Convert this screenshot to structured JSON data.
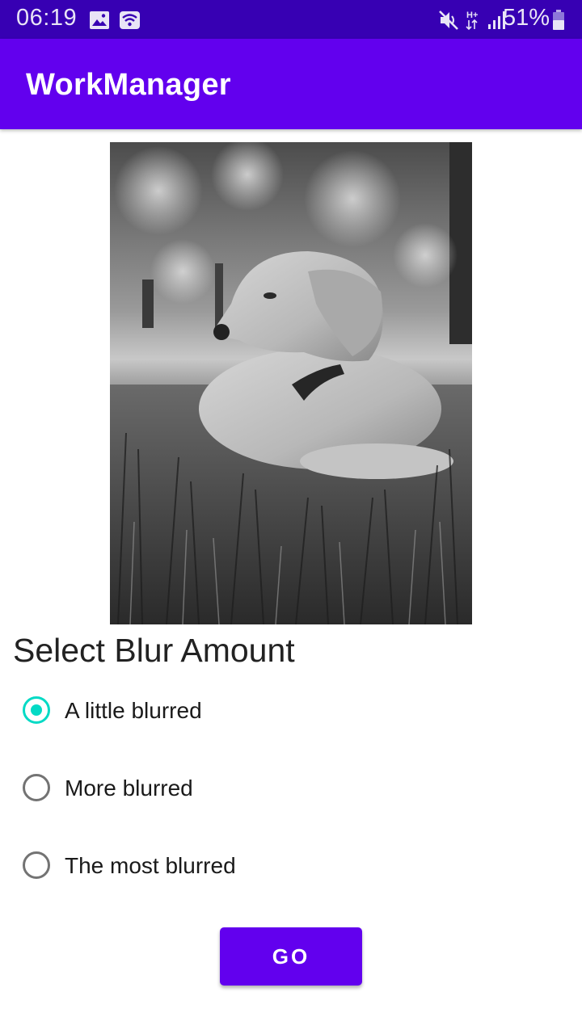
{
  "status_bar": {
    "time": "06:19",
    "battery_percent": "51%",
    "network_label": "H+",
    "left_icons": [
      "gallery-icon",
      "wifi-icon"
    ],
    "right_icons": [
      "mute-icon",
      "network-type-icon",
      "signal-icon",
      "battery-icon"
    ],
    "background": "#3700b3"
  },
  "app_bar": {
    "title": "WorkManager",
    "background": "#6200ee"
  },
  "image": {
    "description_icon": "dog-photo"
  },
  "blur": {
    "title": "Select Blur Amount",
    "options": [
      {
        "label": "A little blurred",
        "checked": true
      },
      {
        "label": "More blurred",
        "checked": false
      },
      {
        "label": "The most blurred",
        "checked": false
      }
    ],
    "accent": "#03dac5"
  },
  "go_button": {
    "label": "GO",
    "color": "#6200ee"
  }
}
